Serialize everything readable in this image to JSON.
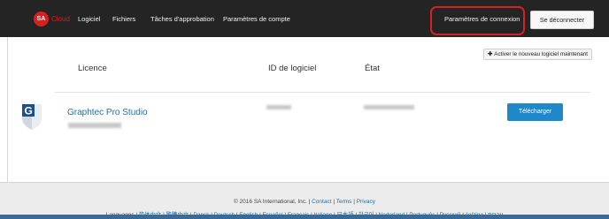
{
  "nav": {
    "logo_badge": "SA",
    "logo_text": "Cloud",
    "items": [
      "Logiciel",
      "Fichiers",
      "Tâches d'approbation",
      "Paramètres de compte"
    ],
    "connection_settings": "Paramètres de connexion",
    "logout": "Se déconnecter"
  },
  "main": {
    "activate_button": "Activer le nouveau logiciel maintenant",
    "columns": [
      "Licence",
      "ID de logiciel",
      "État"
    ],
    "product": {
      "name": "Graphtec Pro Studio",
      "download_label": "Télécharger"
    }
  },
  "footer": {
    "copyright": "© 2016 SA International, Inc. | ",
    "contact": "Contact",
    "terms": "Terms",
    "privacy": "Privacy",
    "sep": " | ",
    "languages_label": "Languages | ",
    "languages": [
      "简体中文",
      "繁體中文",
      "Dansk",
      "Deutsch",
      "English",
      "Español",
      "Français",
      "Italiano",
      "日本語",
      "한국어",
      "Nederland",
      "Português",
      "Русский",
      "čeština",
      "עברית"
    ]
  },
  "colors": {
    "topbar": "#242424",
    "accent": "#1e88c9",
    "highlight": "#d81f26",
    "link": "#1a6fae"
  }
}
